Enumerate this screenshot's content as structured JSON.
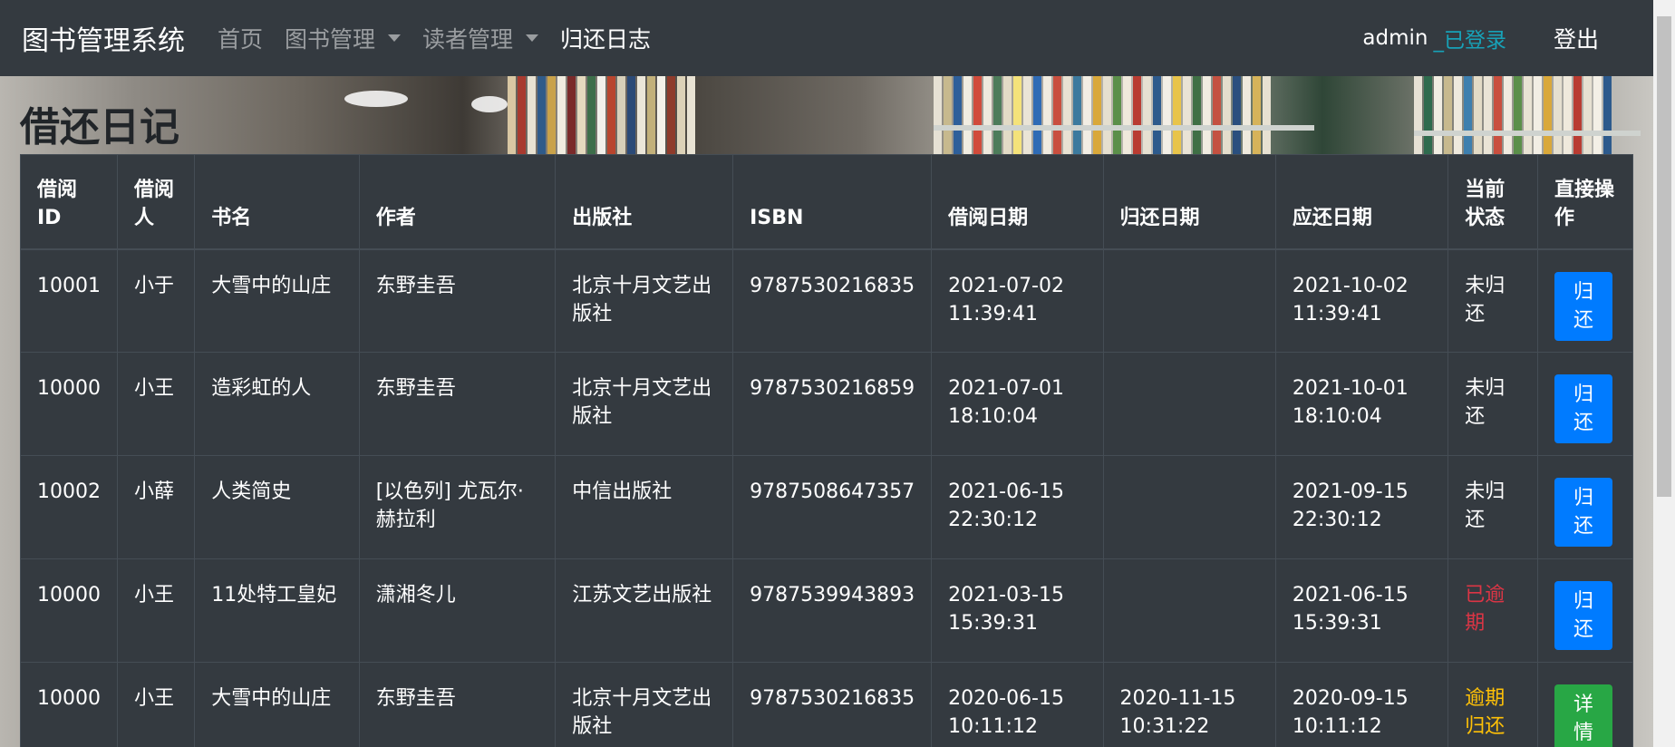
{
  "navbar": {
    "brand": "图书管理系统",
    "items": [
      {
        "label": "首页",
        "dropdown": false,
        "active": false
      },
      {
        "label": "图书管理",
        "dropdown": true,
        "active": false
      },
      {
        "label": "读者管理",
        "dropdown": true,
        "active": false
      },
      {
        "label": "归还日志",
        "dropdown": false,
        "active": true
      }
    ],
    "user": "admin",
    "status": "_已登录",
    "logout": "登出"
  },
  "page_title": "借还日记",
  "table": {
    "headers": [
      "借阅ID",
      "借阅人",
      "书名",
      "作者",
      "出版社",
      "ISBN",
      "借阅日期",
      "归还日期",
      "应还日期",
      "当前状态",
      "直接操作"
    ],
    "rows": [
      {
        "id": "10001",
        "reader": "小于",
        "title": "大雪中的山庄",
        "author": "东野圭吾",
        "publisher": "北京十月文艺出版社",
        "isbn": "9787530216835",
        "borrow_date": "2021-07-02 11:39:41",
        "return_date": "",
        "due_date": "2021-10-02 11:39:41",
        "status": "未归还",
        "status_color": "#ffffff",
        "action": "归还",
        "action_color": "#007bff"
      },
      {
        "id": "10000",
        "reader": "小王",
        "title": "造彩虹的人",
        "author": "东野圭吾",
        "publisher": "北京十月文艺出版社",
        "isbn": "9787530216859",
        "borrow_date": "2021-07-01 18:10:04",
        "return_date": "",
        "due_date": "2021-10-01 18:10:04",
        "status": "未归还",
        "status_color": "#ffffff",
        "action": "归还",
        "action_color": "#007bff"
      },
      {
        "id": "10002",
        "reader": "小薛",
        "title": "人类简史",
        "author": "[以色列] 尤瓦尔·赫拉利",
        "publisher": "中信出版社",
        "isbn": "9787508647357",
        "borrow_date": "2021-06-15 22:30:12",
        "return_date": "",
        "due_date": "2021-09-15 22:30:12",
        "status": "未归还",
        "status_color": "#ffffff",
        "action": "归还",
        "action_color": "#007bff"
      },
      {
        "id": "10000",
        "reader": "小王",
        "title": "11处特工皇妃",
        "author": "潇湘冬儿",
        "publisher": "江苏文艺出版社",
        "isbn": "9787539943893",
        "borrow_date": "2021-03-15 15:39:31",
        "return_date": "",
        "due_date": "2021-06-15 15:39:31",
        "status": "已逾期",
        "status_color": "#dc3545",
        "action": "归还",
        "action_color": "#007bff"
      },
      {
        "id": "10000",
        "reader": "小王",
        "title": "大雪中的山庄",
        "author": "东野圭吾",
        "publisher": "北京十月文艺出版社",
        "isbn": "9787530216835",
        "borrow_date": "2020-06-15 10:11:12",
        "return_date": "2020-11-15 10:31:22",
        "due_date": "2020-09-15 10:11:12",
        "status": "逾期归还",
        "status_color": "#ffc107",
        "action": "详情",
        "action_color": "#28a745"
      }
    ]
  }
}
